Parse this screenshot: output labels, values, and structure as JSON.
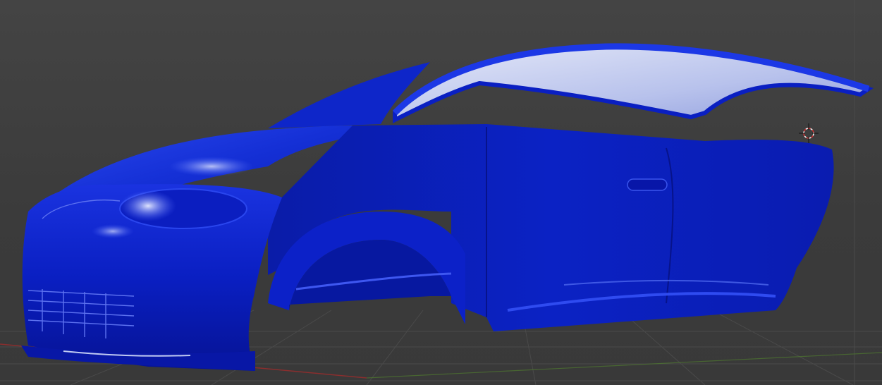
{
  "viewport": {
    "kind": "3d-viewport",
    "background_color": "#3d3d3d",
    "grid_color": "#4a4a4a",
    "x_axis_color": "#8a2e2e",
    "y_axis_color": "#4f7a2f",
    "object": {
      "description_icon": "car-body-mesh",
      "material_color": "#0a1fc2",
      "highlight_color": "#cfd6f5"
    },
    "cursor": {
      "icon": "3d-cursor-icon"
    }
  }
}
